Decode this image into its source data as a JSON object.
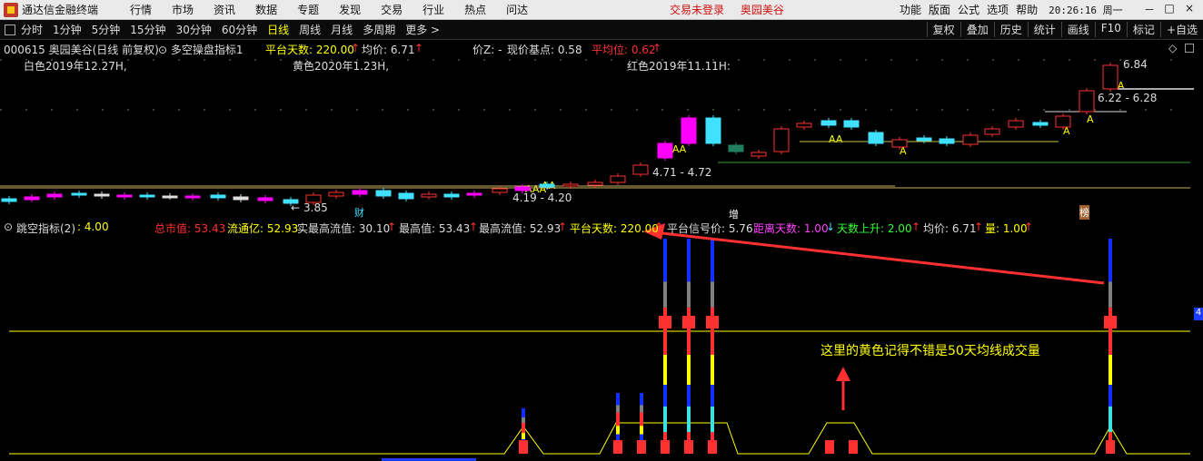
{
  "menubar": {
    "app_title": "通达信金融终端",
    "items": [
      "行情",
      "市场",
      "资讯",
      "数据",
      "专题",
      "发现",
      "交易",
      "行业",
      "热点",
      "问达"
    ],
    "center": [
      "交易未登录",
      "奥园美谷"
    ],
    "right_items": [
      "功能",
      "版面",
      "公式",
      "选项",
      "帮助"
    ],
    "clock": "20:26:16 周一",
    "window_controls": [
      "－",
      "□",
      "×"
    ]
  },
  "toolbar": {
    "periods": [
      "分时",
      "1分钟",
      "5分钟",
      "15分钟",
      "30分钟",
      "60分钟",
      "日线",
      "周线",
      "月线",
      "多周期",
      "更多 >"
    ],
    "active": "日线",
    "right_buttons": [
      "复权",
      "叠加",
      "历史",
      "统计",
      "画线",
      "F10",
      "标记",
      "+自选"
    ]
  },
  "main_info": {
    "code_name": "000615 奥园美谷(日线 前复权)",
    "indicator": "多空操盘指标1",
    "ptd_label": "平台天数: 220.00",
    "avg_label": "均价: 6.71",
    "price_z": "价Z: -",
    "base_point": "现价基点: 0.58",
    "avg_level": "平均位: 0.62",
    "arrow_up": "↑"
  },
  "chart_notes": {
    "white_note": "白色2019年12.27H,",
    "yellow_note": "黄色2020年1.23H,",
    "red_note": "红色2019年11.11H:",
    "high_label": "6.84",
    "range1": "6.22 - 6.28",
    "range2": "4.71 - 4.72",
    "range3": "4.19 - 4.20",
    "low_label": "3.85",
    "aa_marks": [
      "AA",
      "AAA",
      "AAA",
      "A",
      "A",
      "AA",
      "A",
      "AA"
    ],
    "badges": [
      "财",
      "增",
      "榜"
    ]
  },
  "indicator_bar": {
    "name": "跳空指标(2)",
    "value": ": 4.00",
    "total_mv": "总市值: 53.43",
    "float_mv": "流通亿: 52.93",
    "real_high": "实最高流值: 30.10",
    "max_val": "最高值: 53.43",
    "max_float": "最高流值: 52.93",
    "platform_days": "平台天数: 220.00",
    "signal_price": "平台信号价: 5.76",
    "dist_days": "距离天数: 1.00",
    "days_up": "天数上升: 2.00",
    "avg_price": "均价: 6.71",
    "volume": "量: 1.00",
    "right_tag": "4"
  },
  "annotation": "这里的黄色记得不错是50天均线成交量",
  "colors": {
    "up": "#ff3030",
    "down": "#40e0ff",
    "magenta": "#ff00ff",
    "yellow": "#ffff00",
    "blue": "#1030ff",
    "grey": "#808080"
  }
}
